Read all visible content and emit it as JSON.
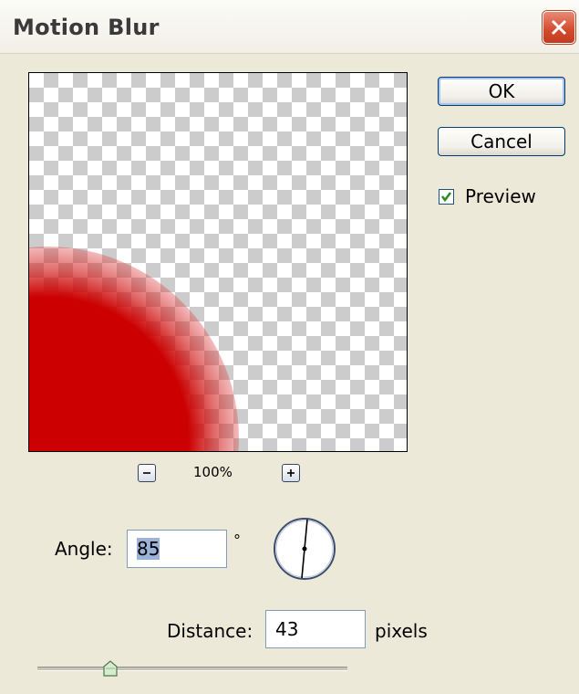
{
  "dialog": {
    "title": "Motion Blur",
    "close_icon": "close-icon"
  },
  "preview": {
    "zoom_level": "100%",
    "zoom_out_icon": "minus-icon",
    "zoom_in_icon": "plus-icon"
  },
  "buttons": {
    "ok_label": "OK",
    "cancel_label": "Cancel"
  },
  "preview_checkbox": {
    "label": "Preview",
    "checked": true
  },
  "angle": {
    "label": "Angle:",
    "value": "85",
    "unit": "°"
  },
  "distance": {
    "label": "Distance:",
    "value": "43",
    "unit": "pixels"
  },
  "colors": {
    "accent_red": "#cc0000",
    "checkbox_check": "#2d8a1f",
    "button_border": "#003c74"
  }
}
